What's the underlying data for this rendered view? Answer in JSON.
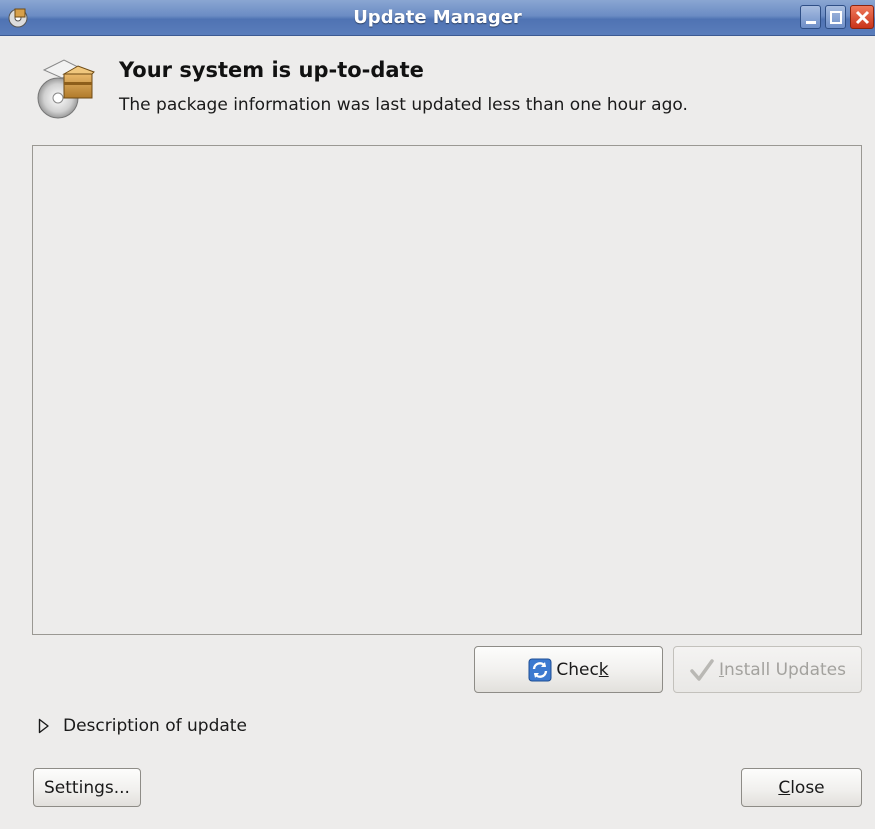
{
  "window": {
    "title": "Update Manager"
  },
  "header": {
    "title": "Your system is up-to-date",
    "subtitle": "The package information was last updated less than one hour ago.",
    "icon": "package-cd-icon"
  },
  "updates_list": {
    "items": []
  },
  "actions": {
    "check": {
      "label_pre": "Chec",
      "label_mnemonic": "k",
      "label_post": "",
      "icon": "refresh-icon",
      "enabled": true
    },
    "install": {
      "label_pre": "",
      "label_mnemonic": "I",
      "label_post": "nstall Updates",
      "icon": "checkmark-icon",
      "enabled": false
    }
  },
  "expander": {
    "label": "Description of update",
    "expanded": false
  },
  "footer": {
    "settings_label": "Settings...",
    "close_pre": "",
    "close_mnemonic": "C",
    "close_post": "lose"
  },
  "colors": {
    "titlebar": "#5a7dbb",
    "background": "#edeceb",
    "disabled_text": "#a3a29e"
  }
}
